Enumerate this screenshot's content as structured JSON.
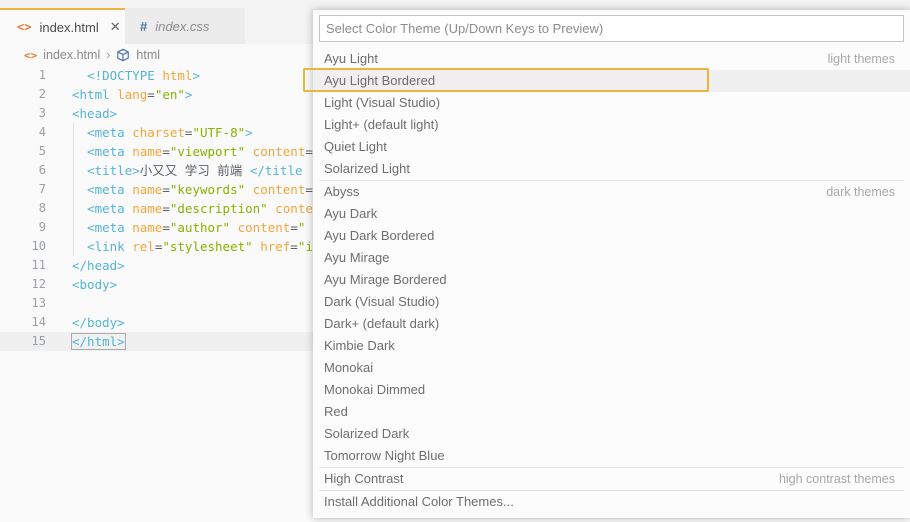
{
  "tabs": [
    {
      "label": "index.html",
      "icon": "<>",
      "icon_name": "html-file-icon",
      "close": "✕"
    },
    {
      "label": "index.css",
      "icon": "#",
      "icon_name": "css-file-icon"
    }
  ],
  "breadcrumb": {
    "file": "index.html",
    "separator": "›",
    "element": "html"
  },
  "editor": {
    "lines": [
      {
        "n": "1",
        "tokens": [
          [
            "x",
            "  "
          ],
          [
            "t",
            "<!"
          ],
          [
            "t",
            "DOCTYPE"
          ],
          [
            "x",
            " "
          ],
          [
            "a",
            "html"
          ],
          [
            "t",
            ">"
          ]
        ]
      },
      {
        "n": "2",
        "tokens": [
          [
            "t",
            "<html"
          ],
          [
            "x",
            " "
          ],
          [
            "a",
            "lang"
          ],
          [
            "x",
            "="
          ],
          [
            "s",
            "\"en\""
          ],
          [
            "t",
            ">"
          ]
        ]
      },
      {
        "n": "3",
        "tokens": [
          [
            "t",
            "<head>"
          ]
        ]
      },
      {
        "n": "4",
        "tokens": [
          [
            "x",
            "  "
          ],
          [
            "t",
            "<meta"
          ],
          [
            "x",
            " "
          ],
          [
            "a",
            "charset"
          ],
          [
            "x",
            "="
          ],
          [
            "s",
            "\"UTF-8\""
          ],
          [
            "t",
            ">"
          ]
        ]
      },
      {
        "n": "5",
        "tokens": [
          [
            "x",
            "  "
          ],
          [
            "t",
            "<meta"
          ],
          [
            "x",
            " "
          ],
          [
            "a",
            "name"
          ],
          [
            "x",
            "="
          ],
          [
            "s",
            "\"viewport\""
          ],
          [
            "x",
            " "
          ],
          [
            "a",
            "content"
          ],
          [
            "x",
            "="
          ]
        ]
      },
      {
        "n": "6",
        "tokens": [
          [
            "x",
            "  "
          ],
          [
            "t",
            "<title>"
          ],
          [
            "x",
            "小又又 学习 前端 "
          ],
          [
            "t",
            "</title"
          ]
        ]
      },
      {
        "n": "7",
        "tokens": [
          [
            "x",
            "  "
          ],
          [
            "t",
            "<meta"
          ],
          [
            "x",
            " "
          ],
          [
            "a",
            "name"
          ],
          [
            "x",
            "="
          ],
          [
            "s",
            "\"keywords\""
          ],
          [
            "x",
            " "
          ],
          [
            "a",
            "content"
          ],
          [
            "x",
            "="
          ]
        ]
      },
      {
        "n": "8",
        "tokens": [
          [
            "x",
            "  "
          ],
          [
            "t",
            "<meta"
          ],
          [
            "x",
            " "
          ],
          [
            "a",
            "name"
          ],
          [
            "x",
            "="
          ],
          [
            "s",
            "\"description\""
          ],
          [
            "x",
            " "
          ],
          [
            "a",
            "conte"
          ]
        ]
      },
      {
        "n": "9",
        "tokens": [
          [
            "x",
            "  "
          ],
          [
            "t",
            "<meta"
          ],
          [
            "x",
            " "
          ],
          [
            "a",
            "name"
          ],
          [
            "x",
            "="
          ],
          [
            "s",
            "\"author\""
          ],
          [
            "x",
            " "
          ],
          [
            "a",
            "content"
          ],
          [
            "x",
            "="
          ],
          [
            "s",
            "\""
          ]
        ]
      },
      {
        "n": "10",
        "tokens": [
          [
            "x",
            "  "
          ],
          [
            "t",
            "<link"
          ],
          [
            "x",
            " "
          ],
          [
            "a",
            "rel"
          ],
          [
            "x",
            "="
          ],
          [
            "s",
            "\"stylesheet\""
          ],
          [
            "x",
            " "
          ],
          [
            "a",
            "href"
          ],
          [
            "x",
            "="
          ],
          [
            "s",
            "\"i"
          ]
        ]
      },
      {
        "n": "11",
        "tokens": [
          [
            "t",
            "</head>"
          ]
        ]
      },
      {
        "n": "12",
        "tokens": [
          [
            "t",
            "<body>"
          ]
        ]
      },
      {
        "n": "13",
        "tokens": []
      },
      {
        "n": "14",
        "tokens": [
          [
            "t",
            "</body>"
          ]
        ]
      },
      {
        "n": "15",
        "tokens": [
          [
            "t",
            "</html>"
          ]
        ]
      }
    ]
  },
  "quickpick": {
    "placeholder": "Select Color Theme (Up/Down Keys to Preview)",
    "groups": [
      {
        "label": "light themes",
        "items": [
          "Ayu Light",
          "Ayu Light Bordered",
          "Light (Visual Studio)",
          "Light+ (default light)",
          "Quiet Light",
          "Solarized Light"
        ]
      },
      {
        "label": "dark themes",
        "items": [
          "Abyss",
          "Ayu Dark",
          "Ayu Dark Bordered",
          "Ayu Mirage",
          "Ayu Mirage Bordered",
          "Dark (Visual Studio)",
          "Dark+ (default dark)",
          "Kimbie Dark",
          "Monokai",
          "Monokai Dimmed",
          "Red",
          "Solarized Dark",
          "Tomorrow Night Blue"
        ]
      },
      {
        "label": "high contrast themes",
        "items": [
          "High Contrast"
        ]
      },
      {
        "label": "",
        "items": [
          "Install Additional Color Themes..."
        ]
      }
    ],
    "selected": "Ayu Light Bordered"
  },
  "colors": {
    "accent": "#f0b33c",
    "tag": "#55b4d4",
    "attr": "#f2a53d",
    "string": "#86b300"
  }
}
